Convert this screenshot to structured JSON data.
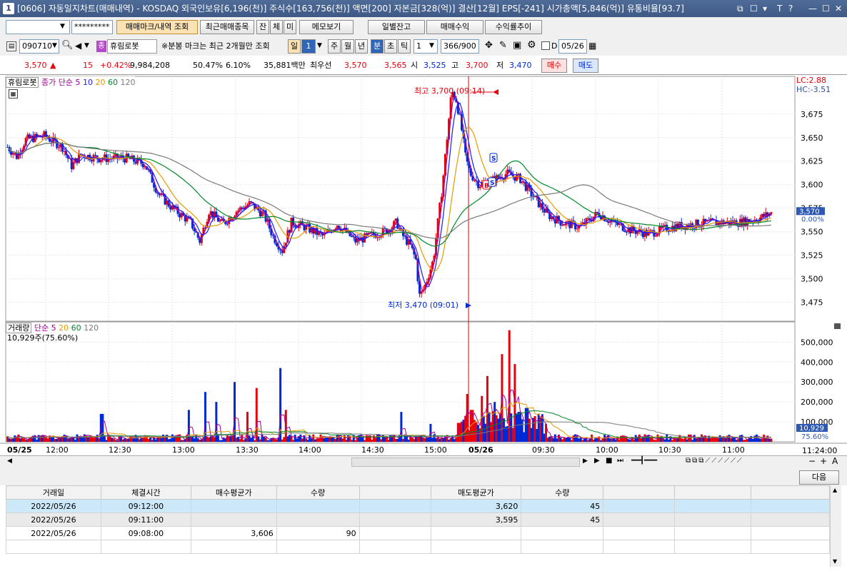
{
  "window": {
    "number": "1",
    "title": "[0606] 자동일지차트(매매내역) - KOSDAQ 외국인보유[6,196(천)] 주식수[163,756(천)] 액면[200] 자본금[328(억)] 결산[12월] EPS[-241] 시가총액[5,846(억)] 유통비율[93.7]",
    "controls": [
      "☐",
      "☐",
      "▼",
      "T",
      "?",
      "—",
      "☐",
      "✕"
    ]
  },
  "toolbar1": {
    "account": "",
    "password": "*********",
    "buttons": [
      "매매마크/내역 조회",
      "최근매매종목",
      "잔",
      "체",
      "미",
      "메모보기",
      "일별잔고",
      "매매수익",
      "수익률추이"
    ]
  },
  "toolbar2": {
    "code": "090710",
    "stock_name": "휴림로봇",
    "notice": "※분봉 마크는 최근 2개월만 조회",
    "period_label": "일",
    "period_value": "1",
    "periods": [
      "주",
      "월",
      "년",
      "분",
      "초",
      "틱"
    ],
    "interval": "1",
    "count": "366/900",
    "date_checkbox_label": "D",
    "date": "05/26"
  },
  "quote": {
    "price": "3,570",
    "arrow": "▲",
    "change": "15",
    "change_pct": "+0.42%",
    "volume": "9,984,208",
    "ratio": "50.47%",
    "turnover": "6.10%",
    "amount": "35,881백만",
    "best_label": "최우선",
    "ask": "3,570",
    "bid": "3,565",
    "open_label": "시",
    "open": "3,525",
    "high_label": "고",
    "high": "3,700",
    "low_label": "저",
    "low": "3,470",
    "buy_btn": "매수",
    "sell_btn": "매도"
  },
  "price_panel": {
    "legend": [
      "휴림로봇",
      "종가 단순 5",
      "10",
      "20",
      "60",
      "120"
    ],
    "lc": "LC:2.88",
    "hc": "HC:-3.51",
    "y_ticks": [
      "3,675",
      "3,650",
      "3,625",
      "3,600",
      "3,575",
      "3,550",
      "3,525",
      "3,500",
      "3,475"
    ],
    "last_price_tag": "3,570",
    "last_pct_tag": "0.00%",
    "high_note": "최고 3,700 (09:14)",
    "low_note": "최저 3,470 (09:01)"
  },
  "volume_panel": {
    "legend": [
      "거래량",
      "단순 5",
      "20",
      "60",
      "120"
    ],
    "last_vol": "10,929주(75.60%)",
    "y_ticks": [
      "500,000",
      "400,000",
      "300,000",
      "200,000",
      "100,000"
    ],
    "last_tag": "10,929",
    "last_pct": "75.60%"
  },
  "x_axis": {
    "labels": [
      "05/25",
      "12:00",
      "12:30",
      "13:00",
      "13:30",
      "14:00",
      "14:30",
      "15:00",
      "05/26",
      "09:30",
      "10:00",
      "10:30",
      "11:00"
    ],
    "clock": "11:24:00"
  },
  "next_button": "다음",
  "trades": {
    "headers": [
      "거래일",
      "체결시간",
      "매수평균가",
      "수량",
      "",
      "매도평균가",
      "수량",
      "",
      "",
      ""
    ],
    "rows": [
      [
        "2022/05/26",
        "09:12:00",
        "",
        "",
        "",
        "3,620",
        "45",
        "",
        "",
        ""
      ],
      [
        "2022/05/26",
        "09:11:00",
        "",
        "",
        "",
        "3,595",
        "45",
        "",
        "",
        ""
      ],
      [
        "2022/05/26",
        "09:08:00",
        "3,606",
        "90",
        "",
        "",
        "",
        "",
        "",
        ""
      ]
    ]
  },
  "colors": {
    "up": "#e8000b",
    "down": "#0029d6",
    "ma5": "#a0009a",
    "ma10": "#1a1aff",
    "ma20": "#e89a00",
    "ma60": "#00882a",
    "ma120": "#7a7a7a"
  }
}
